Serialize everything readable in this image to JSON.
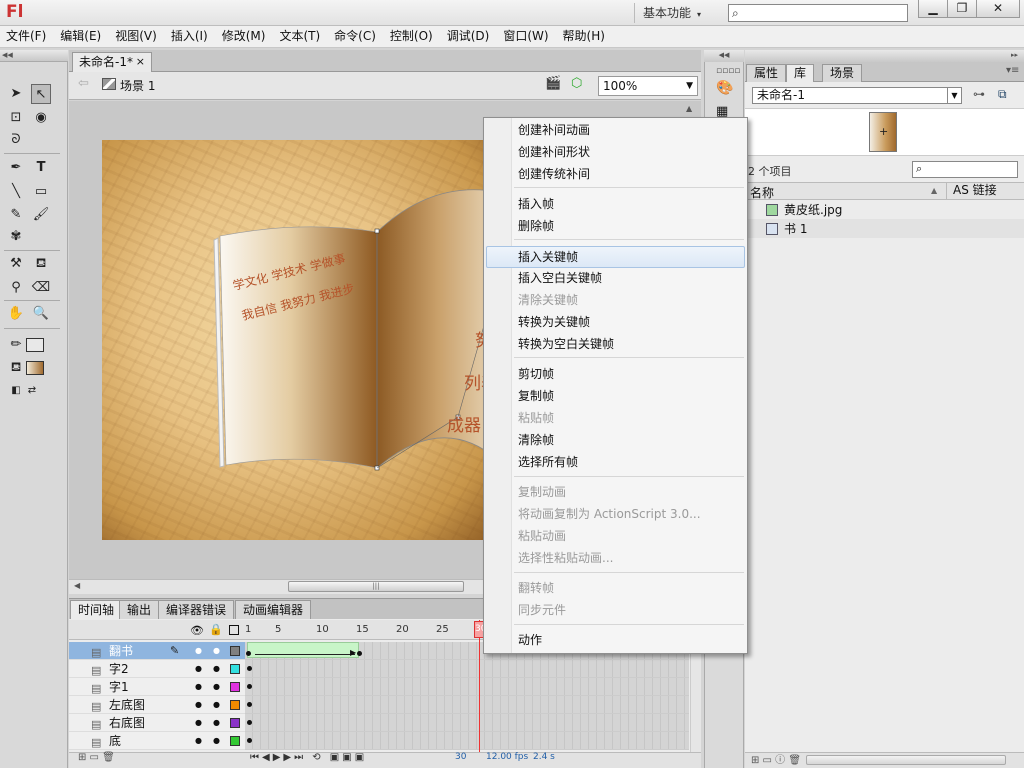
{
  "app": {
    "logo": "Fl",
    "workspace": "基本功能",
    "window_min": "▁",
    "window_max": "❐",
    "window_close": "✕"
  },
  "menu": [
    "文件(F)",
    "编辑(E)",
    "视图(V)",
    "插入(I)",
    "修改(M)",
    "文本(T)",
    "命令(C)",
    "控制(O)",
    "调试(D)",
    "窗口(W)",
    "帮助(H)"
  ],
  "document": {
    "tab": "未命名-1*",
    "close": "×",
    "scene": "场景 1",
    "zoom": "100%"
  },
  "stage": {
    "book_left_line1": "学文化  学技术  学做事",
    "book_left_line2": "我自信  我努力  我进步",
    "book_right_lines": [
      "努",
      "列表",
      "成器"
    ]
  },
  "context_menu": {
    "items": [
      {
        "label": "创建补间动画",
        "disabled": false
      },
      {
        "label": "创建补间形状",
        "disabled": false
      },
      {
        "label": "创建传统补间",
        "disabled": false
      },
      {
        "label": "插入帧",
        "disabled": false
      },
      {
        "label": "删除帧",
        "disabled": false
      },
      {
        "label": "插入关键帧",
        "disabled": false,
        "highlighted": true
      },
      {
        "label": "插入空白关键帧",
        "disabled": false
      },
      {
        "label": "清除关键帧",
        "disabled": true
      },
      {
        "label": "转换为关键帧",
        "disabled": false
      },
      {
        "label": "转换为空白关键帧",
        "disabled": false
      },
      {
        "label": "剪切帧",
        "disabled": false
      },
      {
        "label": "复制帧",
        "disabled": false
      },
      {
        "label": "粘贴帧",
        "disabled": true
      },
      {
        "label": "清除帧",
        "disabled": false
      },
      {
        "label": "选择所有帧",
        "disabled": false
      },
      {
        "label": "复制动画",
        "disabled": true
      },
      {
        "label": "将动画复制为 ActionScript 3.0...",
        "disabled": true
      },
      {
        "label": "粘贴动画",
        "disabled": true
      },
      {
        "label": "选择性粘贴动画...",
        "disabled": true
      },
      {
        "label": "翻转帧",
        "disabled": true
      },
      {
        "label": "同步元件",
        "disabled": true
      },
      {
        "label": "动作",
        "disabled": false
      }
    ]
  },
  "timeline": {
    "tabs": [
      "时间轴",
      "输出",
      "编译器错误",
      "动画编辑器"
    ],
    "frame_numbers": [
      "1",
      "5",
      "10",
      "15",
      "20",
      "25"
    ],
    "playhead_frame": "30",
    "layers": [
      {
        "name": "翻书",
        "color": "#808080",
        "selected": true
      },
      {
        "name": "字2",
        "color": "#33e0e0"
      },
      {
        "name": "字1",
        "color": "#e033e0"
      },
      {
        "name": "左底图",
        "color": "#f08a00"
      },
      {
        "name": "右底图",
        "color": "#8a33c8"
      },
      {
        "name": "底",
        "color": "#33c833"
      }
    ],
    "current_frame": "30",
    "fps": "12.00 fps",
    "time": "2.4 s"
  },
  "library": {
    "tabs": [
      "属性",
      "库",
      "场景"
    ],
    "document_select": "未命名-1",
    "item_count": "2 个项目",
    "col_name": "名称",
    "col_linkage": "AS 链接",
    "items": [
      "黄皮纸.jpg",
      "书 1"
    ]
  }
}
